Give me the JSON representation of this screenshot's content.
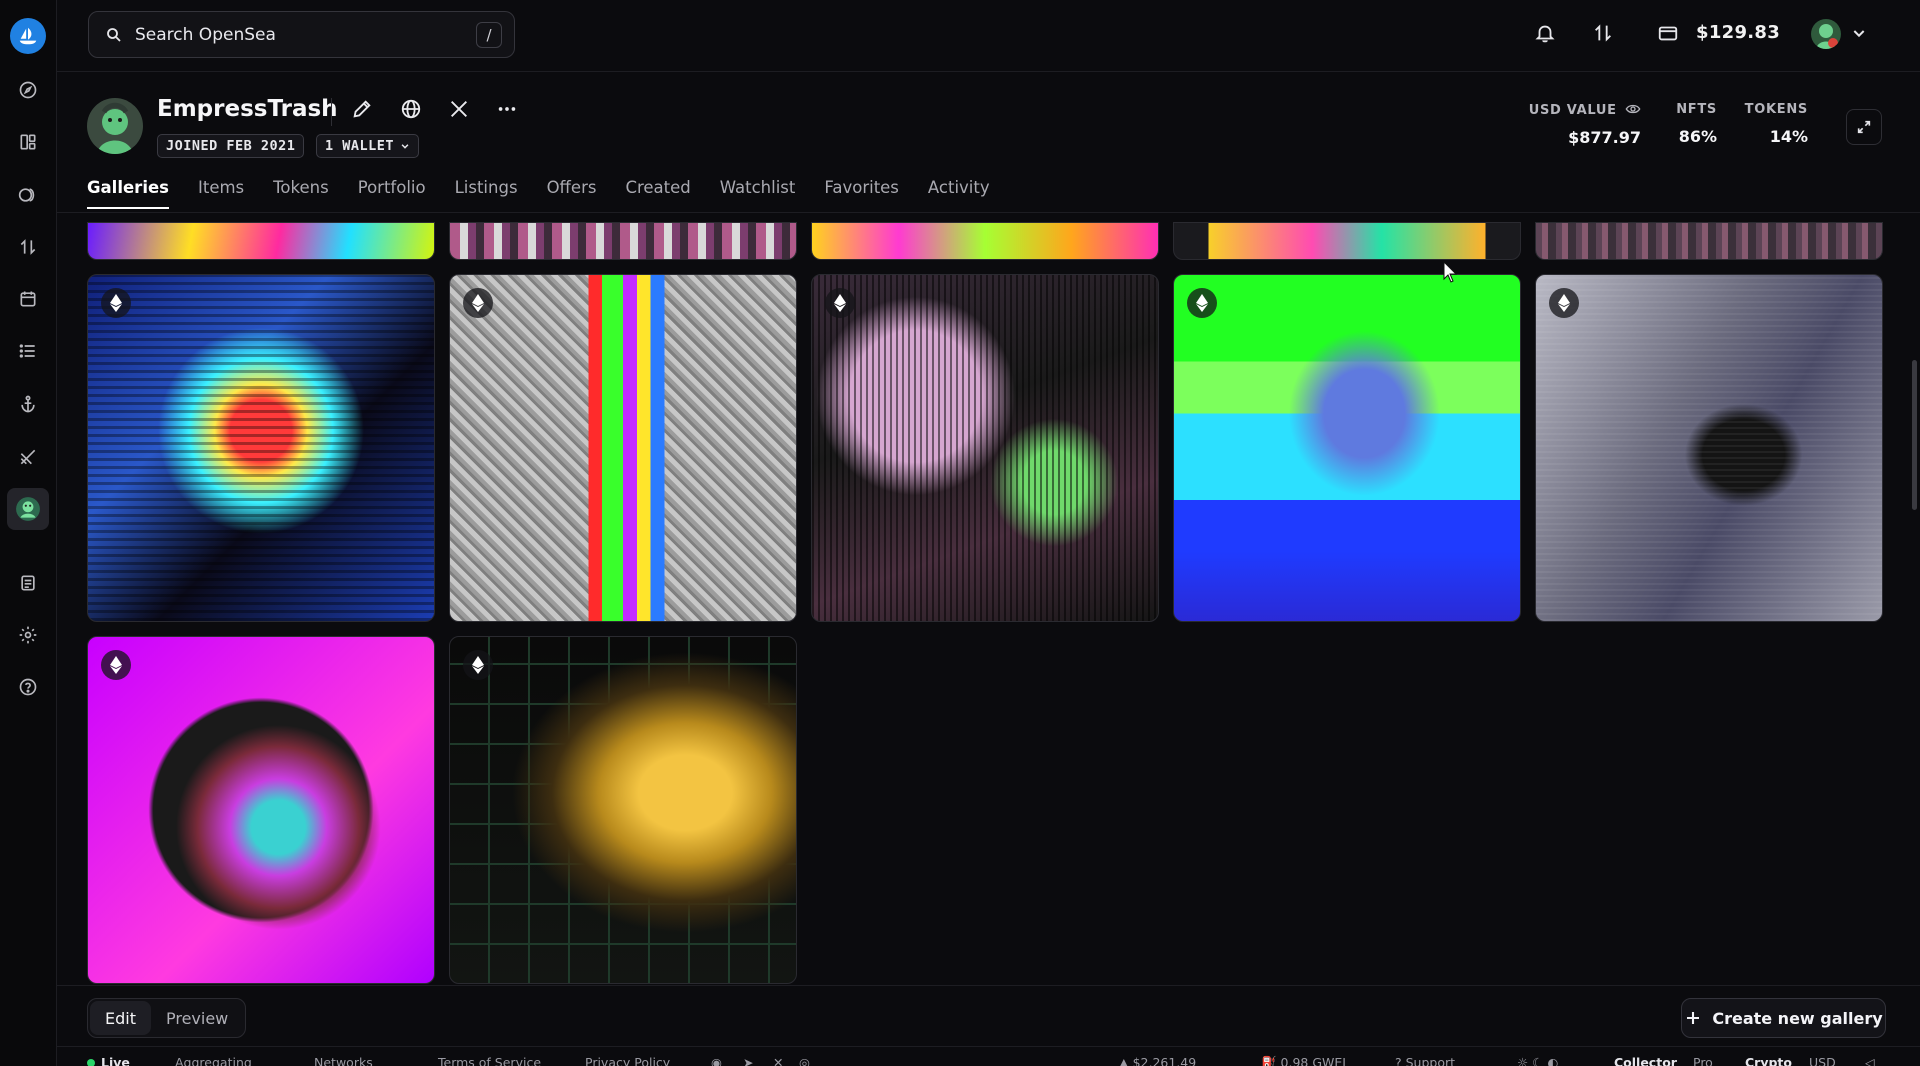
{
  "search": {
    "placeholder": "Search OpenSea",
    "shortcut": "/"
  },
  "topbar": {
    "wallet_balance": "$129.83",
    "icons": [
      "bell-icon",
      "swap-icon",
      "wallet-icon"
    ]
  },
  "sidebar": {
    "items": [
      "compass-icon",
      "collections-icon",
      "token-icon",
      "swap-icon",
      "calendar-icon",
      "list-icon",
      "anchor-icon",
      "brush-icon",
      "profile-icon",
      "docs-icon",
      "settings-icon",
      "help-icon"
    ]
  },
  "profile": {
    "username": "EmpressTrash",
    "joined": "JOINED FEB 2021",
    "wallets": "1 WALLET",
    "stats": [
      {
        "label": "USD VALUE",
        "value": "$877.97"
      },
      {
        "label": "NFTS",
        "value": "86%"
      },
      {
        "label": "TOKENS",
        "value": "14%"
      }
    ]
  },
  "tabs": [
    {
      "label": "Galleries",
      "active": true
    },
    {
      "label": "Items",
      "active": false
    },
    {
      "label": "Tokens",
      "active": false
    },
    {
      "label": "Portfolio",
      "active": false
    },
    {
      "label": "Listings",
      "active": false
    },
    {
      "label": "Offers",
      "active": false
    },
    {
      "label": "Created",
      "active": false
    },
    {
      "label": "Watchlist",
      "active": false
    },
    {
      "label": "Favorites",
      "active": false
    },
    {
      "label": "Activity",
      "active": false
    }
  ],
  "gallery": {
    "chain_icon": "ethereum-icon",
    "rows": 3,
    "items_in_view": 12
  },
  "actions": {
    "edit": "Edit",
    "preview": "Preview",
    "create": "Create new gallery"
  },
  "footer": {
    "live": "Live",
    "aggregating": "Aggregating",
    "networks": "Networks",
    "terms": "Terms of Service",
    "privacy": "Privacy Policy",
    "eth_price": "$2,261.49",
    "gas": "0.98 GWEI",
    "support": "Support",
    "mode_collector": "Collector",
    "mode_pro": "Pro",
    "currency_crypto": "Crypto",
    "currency_usd": "USD"
  },
  "colors": {
    "accent": "#2081e2",
    "background": "#0b0b0e",
    "live": "#2bd66a"
  }
}
